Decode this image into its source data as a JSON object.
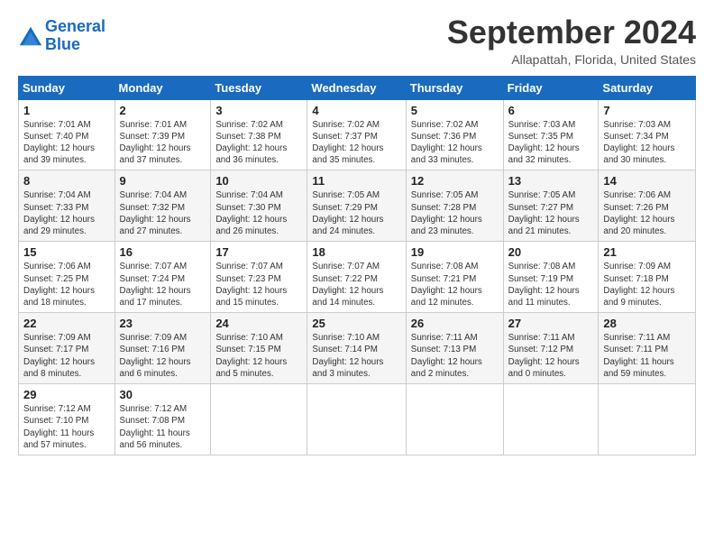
{
  "header": {
    "logo_line1": "General",
    "logo_line2": "Blue",
    "month_title": "September 2024",
    "subtitle": "Allapattah, Florida, United States"
  },
  "days_of_week": [
    "Sunday",
    "Monday",
    "Tuesday",
    "Wednesday",
    "Thursday",
    "Friday",
    "Saturday"
  ],
  "weeks": [
    [
      {
        "day": "1",
        "info": "Sunrise: 7:01 AM\nSunset: 7:40 PM\nDaylight: 12 hours\nand 39 minutes."
      },
      {
        "day": "2",
        "info": "Sunrise: 7:01 AM\nSunset: 7:39 PM\nDaylight: 12 hours\nand 37 minutes."
      },
      {
        "day": "3",
        "info": "Sunrise: 7:02 AM\nSunset: 7:38 PM\nDaylight: 12 hours\nand 36 minutes."
      },
      {
        "day": "4",
        "info": "Sunrise: 7:02 AM\nSunset: 7:37 PM\nDaylight: 12 hours\nand 35 minutes."
      },
      {
        "day": "5",
        "info": "Sunrise: 7:02 AM\nSunset: 7:36 PM\nDaylight: 12 hours\nand 33 minutes."
      },
      {
        "day": "6",
        "info": "Sunrise: 7:03 AM\nSunset: 7:35 PM\nDaylight: 12 hours\nand 32 minutes."
      },
      {
        "day": "7",
        "info": "Sunrise: 7:03 AM\nSunset: 7:34 PM\nDaylight: 12 hours\nand 30 minutes."
      }
    ],
    [
      {
        "day": "8",
        "info": "Sunrise: 7:04 AM\nSunset: 7:33 PM\nDaylight: 12 hours\nand 29 minutes."
      },
      {
        "day": "9",
        "info": "Sunrise: 7:04 AM\nSunset: 7:32 PM\nDaylight: 12 hours\nand 27 minutes."
      },
      {
        "day": "10",
        "info": "Sunrise: 7:04 AM\nSunset: 7:30 PM\nDaylight: 12 hours\nand 26 minutes."
      },
      {
        "day": "11",
        "info": "Sunrise: 7:05 AM\nSunset: 7:29 PM\nDaylight: 12 hours\nand 24 minutes."
      },
      {
        "day": "12",
        "info": "Sunrise: 7:05 AM\nSunset: 7:28 PM\nDaylight: 12 hours\nand 23 minutes."
      },
      {
        "day": "13",
        "info": "Sunrise: 7:05 AM\nSunset: 7:27 PM\nDaylight: 12 hours\nand 21 minutes."
      },
      {
        "day": "14",
        "info": "Sunrise: 7:06 AM\nSunset: 7:26 PM\nDaylight: 12 hours\nand 20 minutes."
      }
    ],
    [
      {
        "day": "15",
        "info": "Sunrise: 7:06 AM\nSunset: 7:25 PM\nDaylight: 12 hours\nand 18 minutes."
      },
      {
        "day": "16",
        "info": "Sunrise: 7:07 AM\nSunset: 7:24 PM\nDaylight: 12 hours\nand 17 minutes."
      },
      {
        "day": "17",
        "info": "Sunrise: 7:07 AM\nSunset: 7:23 PM\nDaylight: 12 hours\nand 15 minutes."
      },
      {
        "day": "18",
        "info": "Sunrise: 7:07 AM\nSunset: 7:22 PM\nDaylight: 12 hours\nand 14 minutes."
      },
      {
        "day": "19",
        "info": "Sunrise: 7:08 AM\nSunset: 7:21 PM\nDaylight: 12 hours\nand 12 minutes."
      },
      {
        "day": "20",
        "info": "Sunrise: 7:08 AM\nSunset: 7:19 PM\nDaylight: 12 hours\nand 11 minutes."
      },
      {
        "day": "21",
        "info": "Sunrise: 7:09 AM\nSunset: 7:18 PM\nDaylight: 12 hours\nand 9 minutes."
      }
    ],
    [
      {
        "day": "22",
        "info": "Sunrise: 7:09 AM\nSunset: 7:17 PM\nDaylight: 12 hours\nand 8 minutes."
      },
      {
        "day": "23",
        "info": "Sunrise: 7:09 AM\nSunset: 7:16 PM\nDaylight: 12 hours\nand 6 minutes."
      },
      {
        "day": "24",
        "info": "Sunrise: 7:10 AM\nSunset: 7:15 PM\nDaylight: 12 hours\nand 5 minutes."
      },
      {
        "day": "25",
        "info": "Sunrise: 7:10 AM\nSunset: 7:14 PM\nDaylight: 12 hours\nand 3 minutes."
      },
      {
        "day": "26",
        "info": "Sunrise: 7:11 AM\nSunset: 7:13 PM\nDaylight: 12 hours\nand 2 minutes."
      },
      {
        "day": "27",
        "info": "Sunrise: 7:11 AM\nSunset: 7:12 PM\nDaylight: 12 hours\nand 0 minutes."
      },
      {
        "day": "28",
        "info": "Sunrise: 7:11 AM\nSunset: 7:11 PM\nDaylight: 11 hours\nand 59 minutes."
      }
    ],
    [
      {
        "day": "29",
        "info": "Sunrise: 7:12 AM\nSunset: 7:10 PM\nDaylight: 11 hours\nand 57 minutes."
      },
      {
        "day": "30",
        "info": "Sunrise: 7:12 AM\nSunset: 7:08 PM\nDaylight: 11 hours\nand 56 minutes."
      },
      {
        "day": "",
        "info": ""
      },
      {
        "day": "",
        "info": ""
      },
      {
        "day": "",
        "info": ""
      },
      {
        "day": "",
        "info": ""
      },
      {
        "day": "",
        "info": ""
      }
    ]
  ]
}
